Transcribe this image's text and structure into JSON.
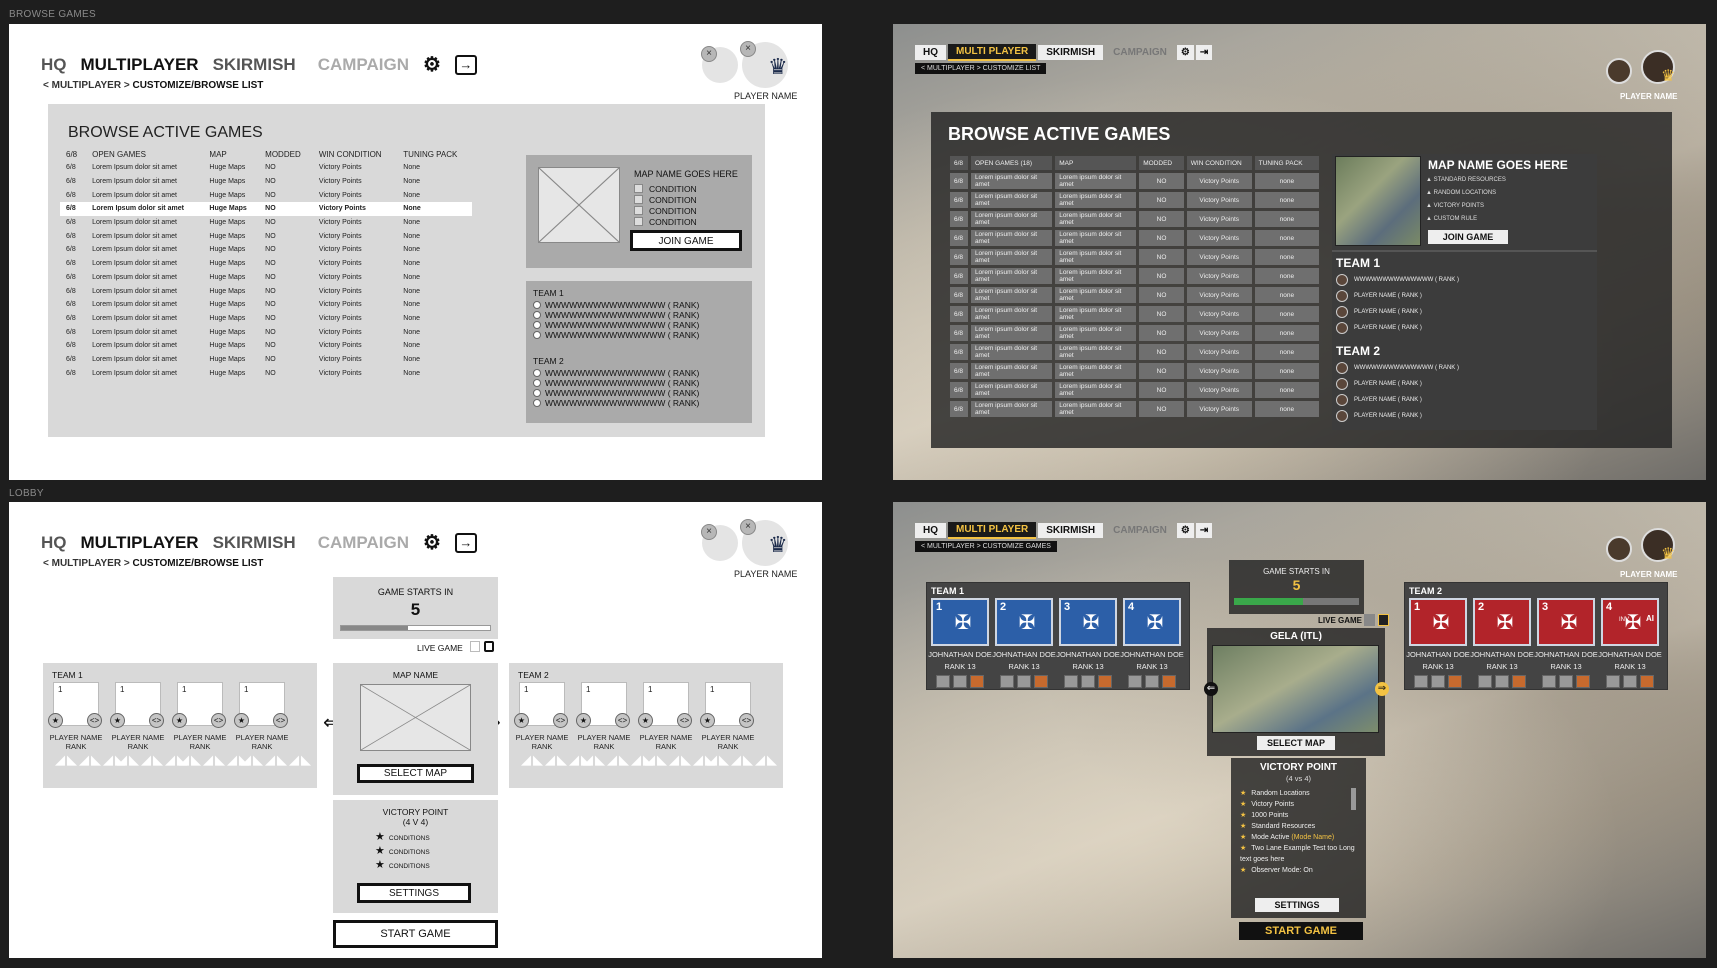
{
  "frames": {
    "browse": "BROWSE GAMES",
    "lobby": "LOBBY"
  },
  "wf_nav": {
    "hq": "HQ",
    "multiplayer": "MULTIPLAYER",
    "skirmish": "SKIRMISH",
    "campaign": "CAMPAIGN",
    "settings_icon": "⚙",
    "exit_icon": "→"
  },
  "wf_crumb": {
    "prefix": "< MULTIPLAYER >",
    "current": "CUSTOMIZE/BROWSE LIST"
  },
  "player": {
    "name": "PLAYER NAME",
    "close": "×",
    "crown": "♛"
  },
  "browse": {
    "title": "BROWSE ACTIVE GAMES",
    "headers": [
      "6/8",
      "OPEN GAMES",
      "MAP",
      "MODDED",
      "WIN CONDITION",
      "TUNING PACK"
    ],
    "row": {
      "slots": "6/8",
      "name": "Lorem Ipsum dolor sit amet",
      "map": "Huge Maps",
      "modded": "NO",
      "win": "Victory Points",
      "pack": "None"
    },
    "map_name": "MAP NAME GOES HERE",
    "condition": "CONDITION",
    "join": "JOIN GAME",
    "team1": "TEAM 1",
    "team2": "TEAM 2",
    "rank_row": "WWWWWWWWWWWWWWW ( RANK)"
  },
  "lobby": {
    "game_starts": "GAME STARTS IN",
    "countdown": "5",
    "countdown_fraction": 0.45,
    "live_game": "LIVE GAME",
    "team1": "TEAM 1",
    "team2": "TEAM 2",
    "slot_num": "1",
    "swap": "<>",
    "star": "★",
    "player_name": "PLAYER NAME",
    "rank": "RANK",
    "ranks": "◢◣◢◣◢◣",
    "map_name": "MAP NAME",
    "select_map": "SELECT MAP",
    "vp_title": "VICTORY POINT",
    "vp_sub": "(4 V 4)",
    "conditions": [
      "CONDITIONS",
      "CONDITIONS",
      "CONDITIONS"
    ],
    "settings": "SETTINGS",
    "start": "START GAME",
    "arrow_left": "⇐",
    "arrow_right": "⇒"
  },
  "mock_nav": {
    "hq": "HQ",
    "multi": "MULTI PLAYER",
    "skirmish": "SKIRMISH",
    "campaign": "CAMPAIGN",
    "gear": "⚙",
    "exit": "⇥"
  },
  "mock_browse": {
    "crumb": "<  MULTIPLAYER  >  CUSTOMIZE LIST",
    "title": "BROWSE ACTIVE GAMES",
    "headers": [
      "6/8",
      "OPEN GAMES (18)",
      "MAP",
      "MODDED",
      "WIN CONDITION",
      "TUNING PACK"
    ],
    "row": {
      "slots": "6/8",
      "name": "Lorem ipsum dolor sit amet",
      "map": "Lorem ipsum dolor sit amet",
      "modded": "NO",
      "win": "Victory Points",
      "pack": "none"
    },
    "map_name": "MAP NAME GOES HERE",
    "conditions": [
      "STANDARD RESOURCES",
      "RANDOM LOCATIONS",
      "VICTORY POINTS",
      "CUSTOM RULE"
    ],
    "join": "JOIN GAME",
    "team1": "TEAM 1",
    "team2": "TEAM 2",
    "host": "WWWWWWWWWWWWWW ( RANK )",
    "member": "PLAYER NAME ( RANK )"
  },
  "mock_lobby": {
    "crumb": "<  MULTIPLAYER  >  CUSTOMIZE GAMES",
    "game_starts": "GAME STARTS IN",
    "countdown": "5",
    "countdown_fraction": 0.55,
    "live_game": "LIVE GAME",
    "map": "GELA (ITL)",
    "select_map": "SELECT MAP",
    "team1": "TEAM 1",
    "team2": "TEAM 2",
    "player": "JOHNATHAN DOE",
    "rank": "RANK 13",
    "ai": "AI",
    "inv": "INV",
    "vp_title": "VICTORY POINT",
    "vp_sub": "(4 vs 4)",
    "settings_list": [
      "Random Locations",
      "Victory Points",
      "1000 Points",
      "Standard Resources",
      "Mode Active",
      "Two Lane Example Test too Long text goes here",
      "Observer Mode: On"
    ],
    "mode_name": "(Mode Name)",
    "settings": "SETTINGS",
    "start": "START GAME"
  },
  "colors": {
    "accent": "#f3c243",
    "team_blue": "#2c5fa8",
    "team_red": "#b2242a",
    "progress": "#3aa84a"
  }
}
